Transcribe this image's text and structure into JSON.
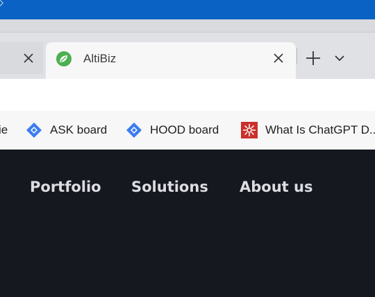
{
  "window": {
    "title_glyph": "◇"
  },
  "tabs": {
    "active": {
      "title": "AltiBiz",
      "favicon": "altibiz-leaf-icon"
    },
    "close_icon": "close-icon",
    "new_tab_icon": "plus-icon",
    "tab_menu_icon": "chevron-down-icon"
  },
  "address_bar": {
    "value": ""
  },
  "bookmarks": {
    "partial_label": "ie",
    "items": [
      {
        "label": "ASK board",
        "icon": "jira-diamond-icon"
      },
      {
        "label": "HOOD board",
        "icon": "jira-diamond-icon"
      },
      {
        "label": "What Is ChatGPT D...",
        "icon": "chatgpt-icon"
      }
    ]
  },
  "site_nav": {
    "items": [
      {
        "label": "Portfolio"
      },
      {
        "label": "Solutions"
      },
      {
        "label": "About us"
      }
    ]
  },
  "colors": {
    "titlebar": "#0a62c4",
    "tab_strip": "#dfe1e5",
    "active_tab": "#f7f7f7",
    "site_background": "#161820",
    "nav_text": "#dcdde2",
    "jira_blue": "#3b7cf0",
    "chatgpt_red": "#c9302c",
    "favicon_green": "#4caf50"
  }
}
